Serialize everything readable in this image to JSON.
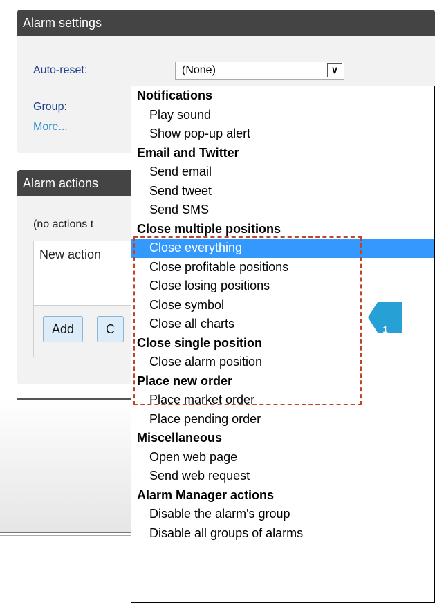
{
  "settings": {
    "title": "Alarm settings",
    "auto_reset_label": "Auto-reset:",
    "auto_reset_value": "(None)",
    "group_label": "Group:",
    "more_link": "More..."
  },
  "actions": {
    "title": "Alarm actions",
    "no_actions_text": "(no actions t",
    "new_action_label": "New action",
    "add_button": "Add",
    "cancel_button": "C"
  },
  "dropdown": {
    "rows": [
      {
        "type": "group",
        "label": "Notifications"
      },
      {
        "type": "item",
        "label": "Play sound"
      },
      {
        "type": "item",
        "label": "Show pop-up alert"
      },
      {
        "type": "group",
        "label": "Email and Twitter"
      },
      {
        "type": "item",
        "label": "Send email"
      },
      {
        "type": "item",
        "label": "Send tweet"
      },
      {
        "type": "item",
        "label": "Send SMS"
      },
      {
        "type": "group",
        "label": "Close multiple positions"
      },
      {
        "type": "item",
        "label": "Close everything",
        "selected": true
      },
      {
        "type": "item",
        "label": "Close profitable positions"
      },
      {
        "type": "item",
        "label": "Close losing positions"
      },
      {
        "type": "item",
        "label": "Close symbol"
      },
      {
        "type": "item",
        "label": "Close all charts"
      },
      {
        "type": "group",
        "label": "Close single position"
      },
      {
        "type": "item",
        "label": "Close alarm position"
      },
      {
        "type": "group",
        "label": "Place new order"
      },
      {
        "type": "item",
        "label": "Place market order"
      },
      {
        "type": "item",
        "label": "Place pending order"
      },
      {
        "type": "group",
        "label": "Miscellaneous"
      },
      {
        "type": "item",
        "label": "Open web page"
      },
      {
        "type": "item",
        "label": "Send web request"
      },
      {
        "type": "group",
        "label": "Alarm Manager actions"
      },
      {
        "type": "item",
        "label": "Disable the alarm's group"
      },
      {
        "type": "item",
        "label": "Disable all groups of alarms"
      }
    ]
  },
  "callout": {
    "label": "1",
    "color": "#27a0d6"
  },
  "colors": {
    "header": "#444444",
    "selected": "#3399ff",
    "highlight": "#c0442a"
  }
}
